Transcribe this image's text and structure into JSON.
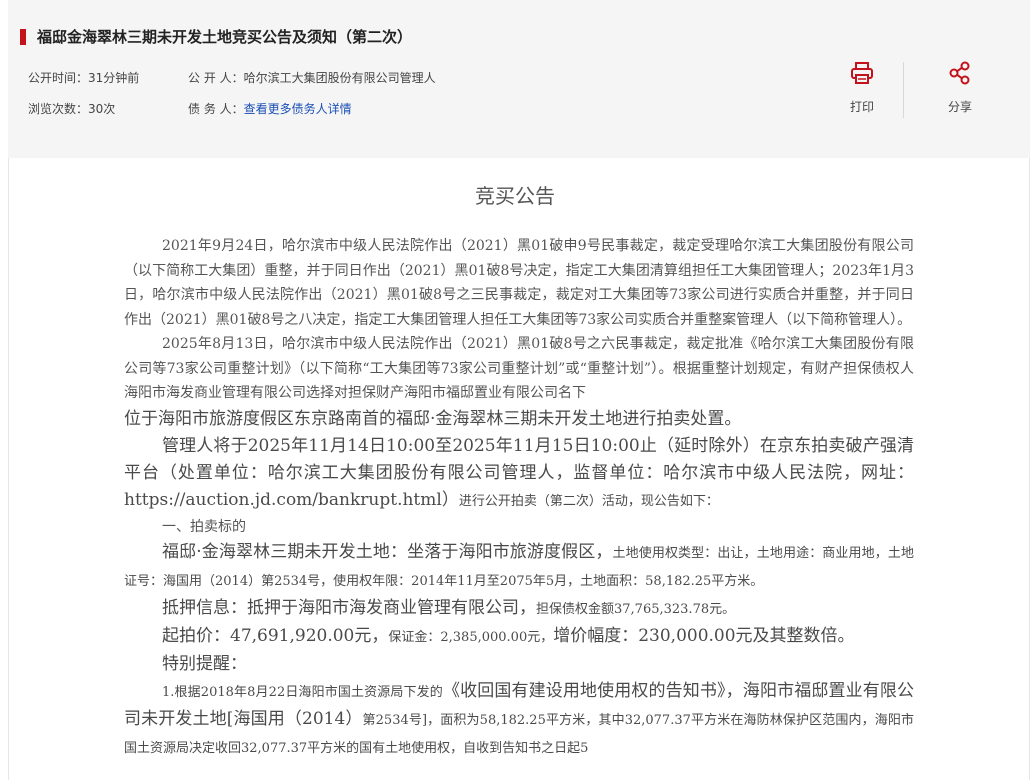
{
  "header": {
    "title": "福邸金海翠林三期未开发土地竞买公告及须知（第二次）",
    "publish_time_label": "公开时间：",
    "publish_time_value": "31分钟前",
    "publisher_label": "公 开 人：",
    "publisher_value": "哈尔滨工大集团股份有限公司管理人",
    "views_label": "浏览次数：",
    "views_value": "30次",
    "debtor_label": "债 务 人：",
    "debtor_link": "查看更多债务人详情",
    "print_label": "打印",
    "share_label": "分享",
    "accent_color": "#c3121b"
  },
  "doc": {
    "title": "竞买公告",
    "p1": "2021年9月24日，哈尔滨市中级人民法院作出（2021）黑01破申9号民事裁定，裁定受理哈尔滨工大集团股份有限公司（以下简称工大集团）重整，并于同日作出（2021）黑01破8号决定，指定工大集团清算组担任工大集团管理人；2023年1月3日，哈尔滨市中级人民法院作出（2021）黑01破8号之三民事裁定，裁定对工大集团等73家公司进行实质合并重整，并于同日作出（2021）黑01破8号之八决定，指定工大集团管理人担任工大集团等73家公司实质合并重整案管理人（以下简称管理人）。",
    "p2a": "2025年8月13日，哈尔滨市中级人民法院作出（2021）黑01破8号之六民事裁定，裁定批准《哈尔滨工大集团股份有限公司等73家公司重整计划》（以下简称“工大集团等73家公司重整计划”或“重整计划”）。根据重整计划规定，有财产担保债权人海阳市海发商业管理有限公司选择对担保财产海阳市福邸置业有限公司名下",
    "p2b": "位于海阳市旅游度假区东京路南首的福邸·金海翠林三期未开发土地进行拍卖处置。",
    "p3a": "管理人将于2025年11月14日10:00至2025年11月15日10:00止（延时除外）在京东拍卖破产强清平台（处置单位：哈尔滨工大集团股份有限公司管理人，监督单位：哈尔滨市中级人民法院，网址：https://auction.jd.com/bankrupt.html）",
    "p3b": "进行公开拍卖（第二次）活动，现公告如下：",
    "section1": "一、拍卖标的",
    "p4a": "福邸·金海翠林三期未开发土地：坐落于海阳市旅游度假区，",
    "p4b": "土地使用权类型：出让，土地用途：商业用地，土地证号：海国用（2014）第2534号，使用权年限：2014年11月至2075年5月，土地面积：58,182.25平方米。",
    "p5a": "抵押信息：抵押于海阳市海发商业管理有限公司，",
    "p5b": "担保债权金额37,765,323.78元。",
    "p6a": "起拍价：47,691,920.00元，",
    "p6b": "保证金：2,385,000.00元，",
    "p6c": "增价幅度：230,000.00元及其整数倍。",
    "p7": "特别提醒：",
    "p8a": "1.根据2018年8月22日海阳市国土资源局下发的",
    "p8b": "《收回国有建设用地使用权的告知书》，海阳市福邸置业有限公司未开发土地[海国用（2014）",
    "p8c": "第2534号]，面积为58,182.25平方米，其中32,077.37平方米在海防林保护区范围内，海阳市国土资源局决定收回32,077.37平方米的国有土地使用权，自收到告知书之日起5"
  }
}
